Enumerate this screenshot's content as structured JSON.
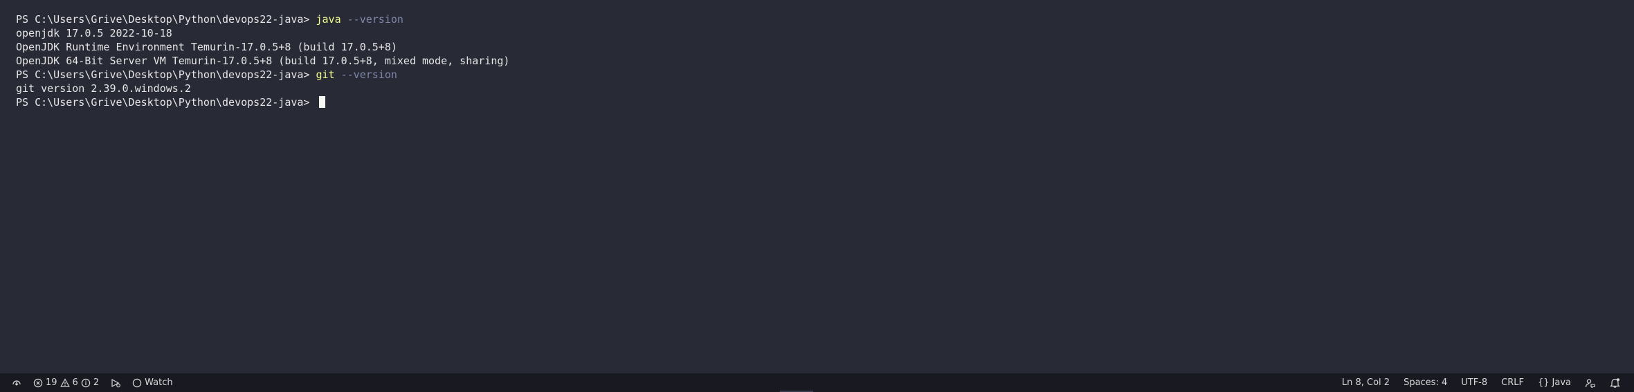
{
  "terminal": {
    "lines": [
      {
        "prompt": "PS C:\\Users\\Grive\\Desktop\\Python\\devops22-java> ",
        "command": "java",
        "args": " --version"
      },
      {
        "text": "openjdk 17.0.5 2022-10-18"
      },
      {
        "text": "OpenJDK Runtime Environment Temurin-17.0.5+8 (build 17.0.5+8)"
      },
      {
        "text": "OpenJDK 64-Bit Server VM Temurin-17.0.5+8 (build 17.0.5+8, mixed mode, sharing)"
      },
      {
        "prompt": "PS C:\\Users\\Grive\\Desktop\\Python\\devops22-java> ",
        "command": "git",
        "args": " --version"
      },
      {
        "text": "git version 2.39.0.windows.2"
      },
      {
        "prompt": "PS C:\\Users\\Grive\\Desktop\\Python\\devops22-java> ",
        "cursor": true
      }
    ],
    "colors": {
      "background": "#282a36",
      "command": "#f1fa8c",
      "args": "#7f86a8",
      "text": "#e6e6e6"
    }
  },
  "statusbar": {
    "remote_icon": "remote-icon",
    "errors": "19",
    "warnings": "6",
    "infos": "2",
    "watch_label": "Watch",
    "position": "Ln 8, Col 2",
    "spaces": "Spaces: 4",
    "encoding": "UTF-8",
    "eol": "CRLF",
    "language": "Java",
    "language_icon": "{}",
    "colors": {
      "background": "#191a21",
      "text": "#d8d8d8"
    }
  }
}
